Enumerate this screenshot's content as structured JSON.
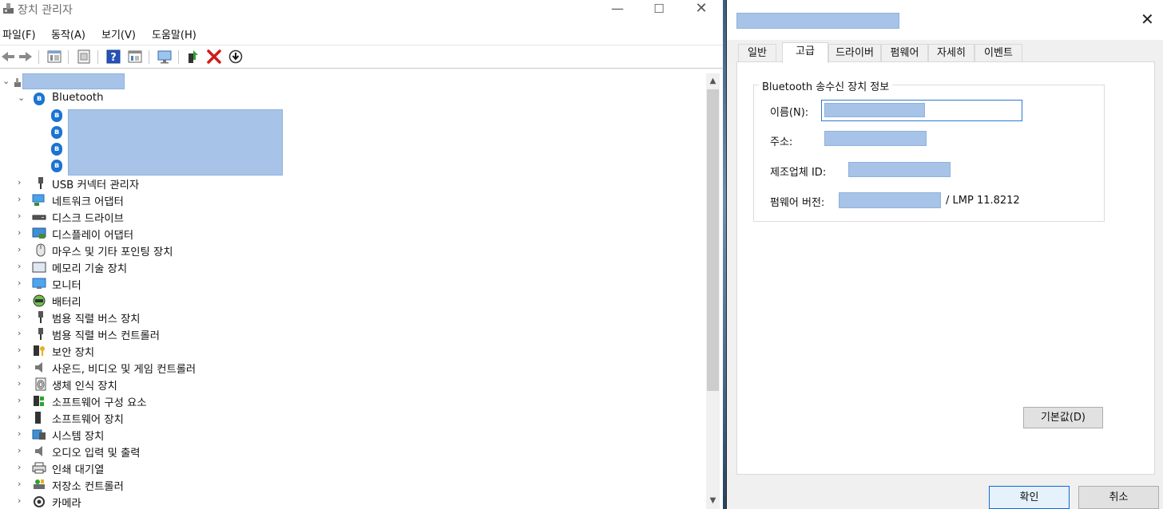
{
  "devmgr": {
    "title": "장치 관리자",
    "window_controls": {
      "min": "—",
      "max": "☐",
      "close": "✕"
    },
    "menu": [
      "파일(F)",
      "동작(A)",
      "보기(V)",
      "도움말(H)"
    ],
    "toolbar_icons": [
      "back-icon",
      "forward-icon",
      "tree-view-icon",
      "properties-icon",
      "help-icon",
      "view-icon",
      "monitor-icon",
      "update-driver-icon",
      "uninstall-icon",
      "download-icon"
    ],
    "tree": {
      "bluetooth_label": "Bluetooth",
      "categories": [
        "USB 커넥터 관리자",
        "네트워크 어댑터",
        "디스크 드라이브",
        "디스플레이 어댑터",
        "마우스 및 기타 포인팅 장치",
        "메모리 기술 장치",
        "모니터",
        "배터리",
        "범용 직렬 버스 장치",
        "범용 직렬 버스 컨트롤러",
        "보안 장치",
        "사운드, 비디오 및 게임 컨트롤러",
        "생체 인식 장치",
        "소프트웨어 구성 요소",
        "소프트웨어 장치",
        "시스템 장치",
        "오디오 입력 및 출력",
        "인쇄 대기열",
        "저장소 컨트롤러",
        "카메라"
      ]
    }
  },
  "props": {
    "close": "✕",
    "tabs": [
      "일반",
      "고급",
      "드라이버",
      "펌웨어",
      "자세히",
      "이벤트"
    ],
    "active_tab": "고급",
    "group_title": "Bluetooth 송수신 장치 정보",
    "name_label": "이름(N):",
    "address_label": "주소:",
    "manufacturer_label": "제조업체 ID:",
    "firmware_label": "펌웨어 버전:",
    "lmp_text": "/  LMP 11.8212",
    "default_button": "기본값(D)",
    "ok_button": "확인",
    "cancel_button": "취소"
  }
}
